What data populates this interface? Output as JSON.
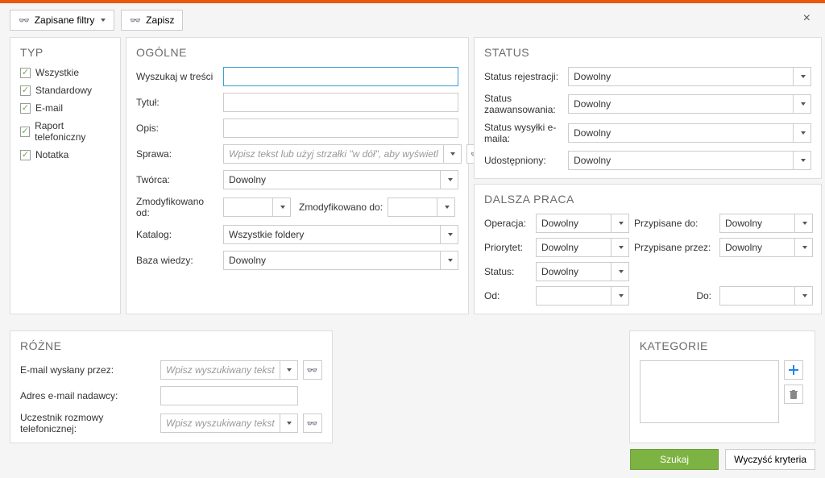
{
  "toolbar": {
    "saved_filters_label": "Zapisane filtry",
    "save_label": "Zapisz"
  },
  "close_icon": "×",
  "typ": {
    "title": "TYP",
    "items": [
      {
        "label": "Wszystkie",
        "checked": true
      },
      {
        "label": "Standardowy",
        "checked": true
      },
      {
        "label": "E-mail",
        "checked": true
      },
      {
        "label": "Raport telefoniczny",
        "checked": true
      },
      {
        "label": "Notatka",
        "checked": true
      }
    ]
  },
  "ogolne": {
    "title": "OGÓLNE",
    "search_content_label": "Wyszukaj w treści",
    "title_label": "Tytuł:",
    "desc_label": "Opis:",
    "case_label": "Sprawa:",
    "case_placeholder": "Wpisz tekst lub użyj strzałki \"w dół\", aby wyświetl",
    "author_label": "Twórca:",
    "author_value": "Dowolny",
    "modified_from_label": "Zmodyfikowano od:",
    "modified_to_label": "Zmodyfikowano do:",
    "catalog_label": "Katalog:",
    "catalog_value": "Wszystkie foldery",
    "kb_label": "Baza wiedzy:",
    "kb_value": "Dowolny"
  },
  "status": {
    "title": "STATUS",
    "rows": [
      {
        "label": "Status rejestracji:",
        "value": "Dowolny"
      },
      {
        "label": "Status zaawansowania:",
        "value": "Dowolny"
      },
      {
        "label": "Status wysyłki e-maila:",
        "value": "Dowolny"
      },
      {
        "label": "Udostępniony:",
        "value": "Dowolny"
      }
    ]
  },
  "dalsza": {
    "title": "DALSZA PRACA",
    "operation_label": "Operacja:",
    "operation_value": "Dowolny",
    "assigned_to_label": "Przypisane do:",
    "assigned_to_value": "Dowolny",
    "priority_label": "Priorytet:",
    "priority_value": "Dowolny",
    "assigned_by_label": "Przypisane przez:",
    "assigned_by_value": "Dowolny",
    "status_label": "Status:",
    "status_value": "Dowolny",
    "from_label": "Od:",
    "to_label": "Do:"
  },
  "rozne": {
    "title": "RÓŻNE",
    "email_sent_by_label": "E-mail wysłany przez:",
    "search_placeholder": "Wpisz wyszukiwany tekst",
    "sender_address_label": "Adres e-mail nadawcy:",
    "call_participant_label": "Uczestnik rozmowy telefonicznej:"
  },
  "kategorie": {
    "title": "KATEGORIE"
  },
  "footer": {
    "search": "Szukaj",
    "clear": "Wyczyść kryteria"
  },
  "icons": {
    "plus_color": "#1e88e5",
    "trash_color": "#888"
  }
}
